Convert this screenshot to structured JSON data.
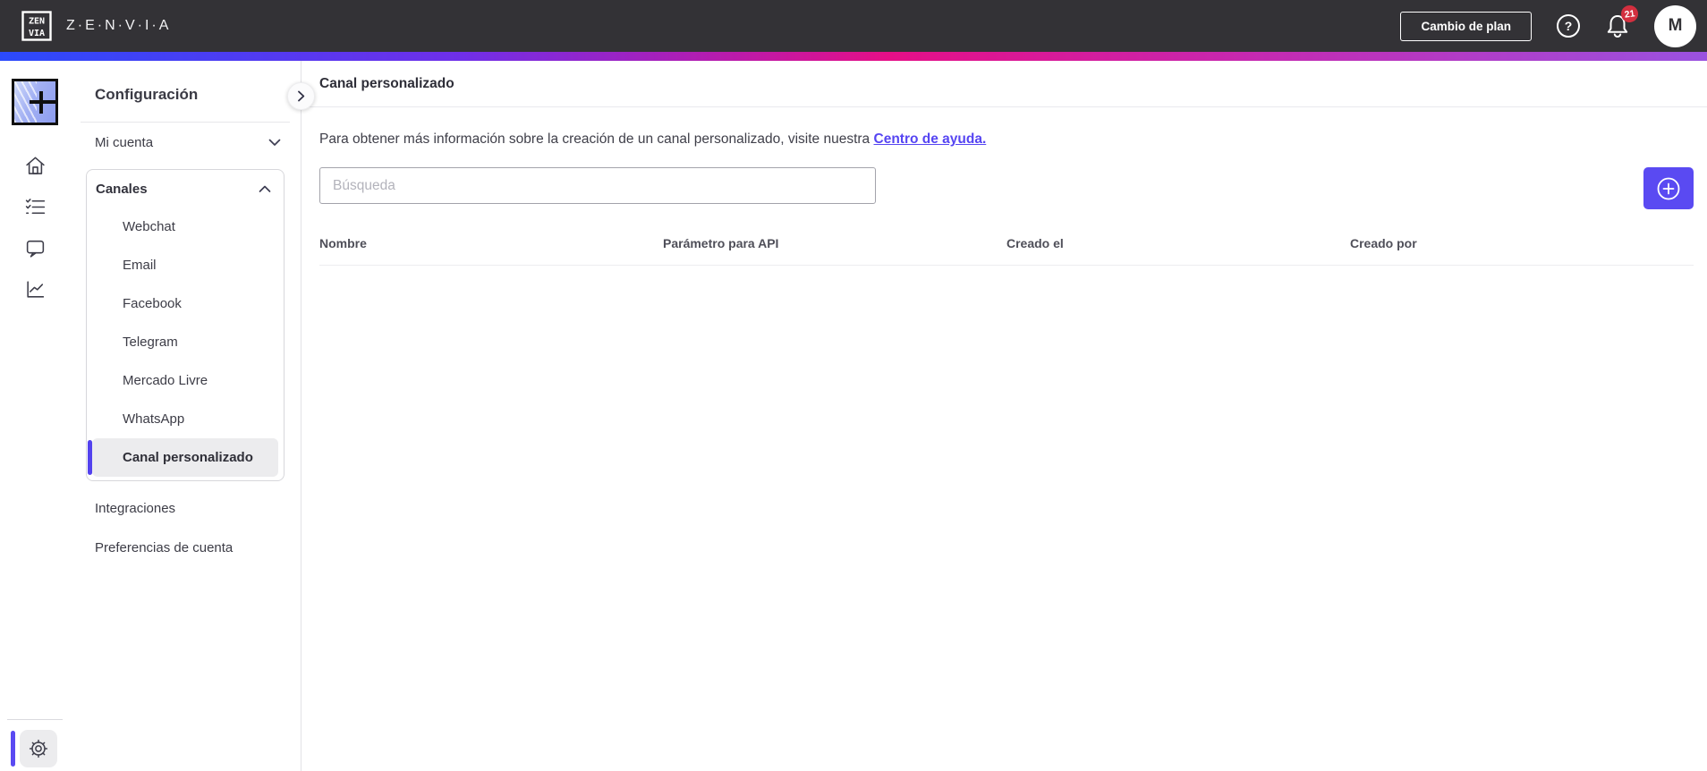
{
  "topbar": {
    "logo_text_top": "ZEN",
    "logo_text_bottom": "VIA",
    "brand_wordmark": "Z·E·N·V·I·A",
    "change_plan_label": "Cambio de plan",
    "notification_count": "21",
    "avatar_initial": "M"
  },
  "sidebar": {
    "title": "Configuración",
    "my_account_label": "Mi cuenta",
    "channels": {
      "label": "Canales",
      "items": [
        {
          "label": "Webchat",
          "selected": false
        },
        {
          "label": "Email",
          "selected": false
        },
        {
          "label": "Facebook",
          "selected": false
        },
        {
          "label": "Telegram",
          "selected": false
        },
        {
          "label": "Mercado Livre",
          "selected": false
        },
        {
          "label": "WhatsApp",
          "selected": false
        },
        {
          "label": "Canal personalizado",
          "selected": true
        }
      ]
    },
    "integrations_label": "Integraciones",
    "account_preferences_label": "Preferencias de cuenta"
  },
  "main": {
    "page_title": "Canal personalizado",
    "description_text": "Para obtener más información sobre la creación de un canal personalizado, visite nuestra",
    "help_link_label": "Centro de ayuda.",
    "search": {
      "placeholder": "Búsqueda",
      "value": ""
    },
    "table": {
      "columns": [
        "Nombre",
        "Parámetro para API",
        "Creado el",
        "Creado por"
      ],
      "rows": []
    }
  },
  "colors": {
    "topbar_bg": "#333236",
    "accent_purple": "#5a4af2",
    "link_purple": "#5645f2",
    "badge_red": "#d32f3f",
    "selected_item_bg": "#ececee",
    "gradient_stripe": [
      "#2b4afb",
      "#6f2fe9",
      "#e50f87",
      "#9a52e0"
    ]
  }
}
